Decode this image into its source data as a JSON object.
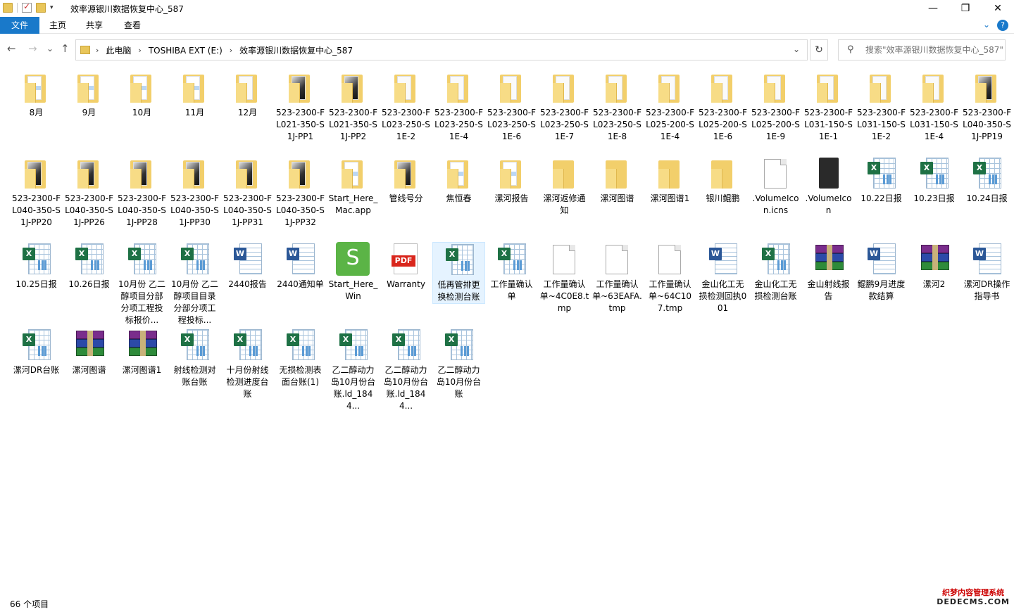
{
  "window": {
    "title": "效率源银川数据恢复中心_587",
    "minimize": "—",
    "maximize": "❐",
    "close": "✕"
  },
  "ribbon": {
    "tabs": [
      "文件",
      "主页",
      "共享",
      "查看"
    ],
    "expand": "⌄",
    "help": "?"
  },
  "nav": {
    "back": "←",
    "forward": "→",
    "recent": "⌄",
    "up": "↑",
    "breadcrumb": [
      "此电脑",
      "TOSHIBA EXT (E:)",
      "效率源银川数据恢复中心_587"
    ],
    "crumb_sep": "›",
    "dropdown": "⌄",
    "refresh": "↻"
  },
  "search": {
    "icon": "search-icon",
    "placeholder": "搜索\"效率源银川数据恢复中心_587\""
  },
  "items": [
    {
      "label": "8月",
      "type": "folder",
      "variant": "blue"
    },
    {
      "label": "9月",
      "type": "folder",
      "variant": "blue"
    },
    {
      "label": "10月",
      "type": "folder",
      "variant": "blue"
    },
    {
      "label": "11月",
      "type": "folder",
      "variant": "blue"
    },
    {
      "label": "12月",
      "type": "folder",
      "variant": "plain"
    },
    {
      "label": "523-2300-FL021-350-S1J-PP1",
      "type": "folder",
      "variant": "dark"
    },
    {
      "label": "523-2300-FL021-350-S1J-PP2",
      "type": "folder",
      "variant": "dark"
    },
    {
      "label": "523-2300-FL023-250-S1E-2",
      "type": "folder",
      "variant": "plain"
    },
    {
      "label": "523-2300-FL023-250-S1E-4",
      "type": "folder",
      "variant": "plain"
    },
    {
      "label": "523-2300-FL023-250-S1E-6",
      "type": "folder",
      "variant": "plain"
    },
    {
      "label": "523-2300-FL023-250-S1E-7",
      "type": "folder",
      "variant": "plain"
    },
    {
      "label": "523-2300-FL023-250-S1E-8",
      "type": "folder",
      "variant": "plain"
    },
    {
      "label": "523-2300-FL025-200-S1E-4",
      "type": "folder",
      "variant": "plain"
    },
    {
      "label": "523-2300-FL025-200-S1E-6",
      "type": "folder",
      "variant": "plain"
    },
    {
      "label": "523-2300-FL025-200-S1E-9",
      "type": "folder",
      "variant": "plain"
    },
    {
      "label": "523-2300-FL031-150-S1E-1",
      "type": "folder",
      "variant": "plain"
    },
    {
      "label": "523-2300-FL031-150-S1E-2",
      "type": "folder",
      "variant": "plain"
    },
    {
      "label": "523-2300-FL031-150-S1E-4",
      "type": "folder",
      "variant": "plain"
    },
    {
      "label": "523-2300-FL040-350-S1J-PP19",
      "type": "folder",
      "variant": "dark"
    },
    {
      "label": "523-2300-FL040-350-S1J-PP20",
      "type": "folder",
      "variant": "dark"
    },
    {
      "label": "523-2300-FL040-350-S1J-PP26",
      "type": "folder",
      "variant": "dark"
    },
    {
      "label": "523-2300-FL040-350-S1J-PP28",
      "type": "folder",
      "variant": "dark"
    },
    {
      "label": "523-2300-FL040-350-S1J-PP30",
      "type": "folder",
      "variant": "dark"
    },
    {
      "label": "523-2300-FL040-350-S1J-PP31",
      "type": "folder",
      "variant": "dark"
    },
    {
      "label": "523-2300-FL040-350-S1J-PP32",
      "type": "folder",
      "variant": "dark"
    },
    {
      "label": "Start_Here_Mac.app",
      "type": "folder",
      "variant": "blue"
    },
    {
      "label": "管线号分",
      "type": "folder",
      "variant": "dark"
    },
    {
      "label": "焦恒春",
      "type": "folder",
      "variant": "blue"
    },
    {
      "label": "漯河报告",
      "type": "folder",
      "variant": "blue"
    },
    {
      "label": "漯河返修通知",
      "type": "folder",
      "variant": "empty"
    },
    {
      "label": "漯河图谱",
      "type": "folder",
      "variant": "empty"
    },
    {
      "label": "漯河图谱1",
      "type": "folder",
      "variant": "empty"
    },
    {
      "label": "银川鲲鹏",
      "type": "folder",
      "variant": "empty"
    },
    {
      "label": ".VolumeIcon.icns",
      "type": "file"
    },
    {
      "label": ".VolumeIcon",
      "type": "drive"
    },
    {
      "label": "10.22日报",
      "type": "excel"
    },
    {
      "label": "10.23日报",
      "type": "excel"
    },
    {
      "label": "10.24日报",
      "type": "excel"
    },
    {
      "label": "10.25日报",
      "type": "excel"
    },
    {
      "label": "10.26日报",
      "type": "excel"
    },
    {
      "label": "10月份 乙二醇项目分部分项工程投标报价...",
      "type": "excel"
    },
    {
      "label": "10月份 乙二醇项目目录分部分项工程投标...",
      "type": "excel"
    },
    {
      "label": "2440报告",
      "type": "word"
    },
    {
      "label": "2440通知单",
      "type": "word"
    },
    {
      "label": "Start_Here_Win",
      "type": "seagate"
    },
    {
      "label": "Warranty",
      "type": "pdf"
    },
    {
      "label": "低再管排更换检测台账",
      "type": "excel",
      "selected": true
    },
    {
      "label": "工作量确认单",
      "type": "excel"
    },
    {
      "label": "工作量确认单~4C0E8.tmp",
      "type": "file"
    },
    {
      "label": "工作量确认单~63EAFA.tmp",
      "type": "file"
    },
    {
      "label": "工作量确认单~64C107.tmp",
      "type": "file"
    },
    {
      "label": "金山化工无损检测回执001",
      "type": "word"
    },
    {
      "label": "金山化工无损检测台账",
      "type": "excel"
    },
    {
      "label": "金山射线报告",
      "type": "rar"
    },
    {
      "label": "鲲鹏9月进度款结算",
      "type": "word"
    },
    {
      "label": "漯河2",
      "type": "rar"
    },
    {
      "label": "漯河DR操作指导书",
      "type": "word"
    },
    {
      "label": "漯河DR台账",
      "type": "excel"
    },
    {
      "label": "漯河图谱",
      "type": "rar"
    },
    {
      "label": "漯河图谱1",
      "type": "rar"
    },
    {
      "label": "射线检测对账台账",
      "type": "excel"
    },
    {
      "label": "十月份射线检测进度台账",
      "type": "excel"
    },
    {
      "label": "无损检测表面台账(1)",
      "type": "excel"
    },
    {
      "label": "乙二醇动力岛10月份台账.ld_1844...",
      "type": "excel"
    },
    {
      "label": "乙二醇动力岛10月份台账.ld_1844...",
      "type": "excel"
    },
    {
      "label": "乙二醇动力岛10月份台账",
      "type": "excel"
    }
  ],
  "status": {
    "count": "66 个项目"
  },
  "watermark": {
    "line1": "织梦内容管理系统",
    "line2": "DEDECMS.COM"
  },
  "colors": {
    "accent": "#1979ca",
    "selection": "#e5f3ff",
    "folder": "#f2cf6b",
    "excel": "#1e7145",
    "word": "#2b5797",
    "pdf": "#d9261c",
    "seagate": "#5bb446"
  }
}
